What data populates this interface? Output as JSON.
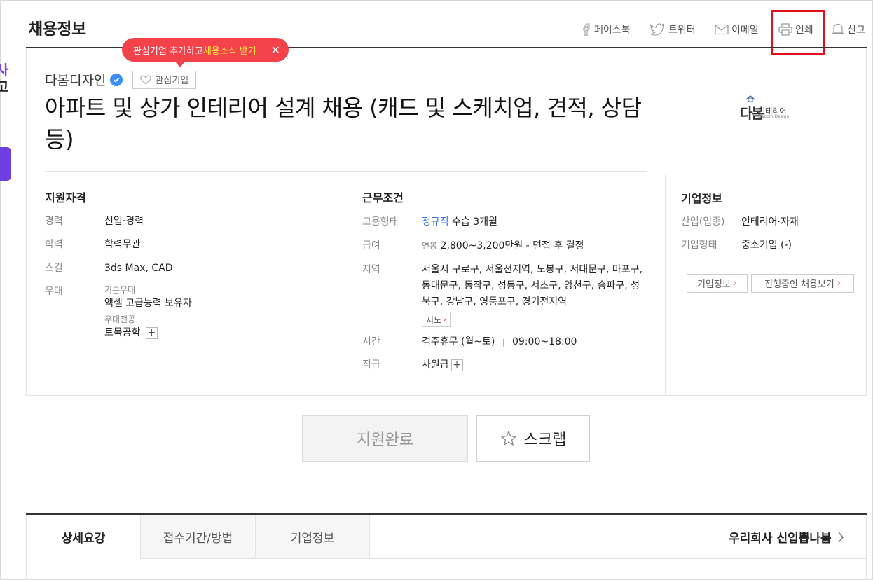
{
  "left_ad": {
    "text1": "사",
    "text2": "고"
  },
  "header": {
    "title": "채용정보",
    "share": {
      "facebook": "페이스북",
      "twitter": "트위터",
      "email": "이메일",
      "print": "인쇄",
      "report": "신고"
    }
  },
  "tooltip": {
    "text_before": "관심기업 추가하고 ",
    "text_highlight": "채용소식 받기",
    "close": "✕"
  },
  "company": {
    "name": "다봄디자인",
    "fav_label": "관심기업"
  },
  "job": {
    "title": "아파트 및 상가 인테리어 설계 채용 (캐드 및 스케치업, 견적, 상담 등)"
  },
  "qualifications": {
    "title": "지원자격",
    "career_label": "경력",
    "career_value": "신입·경력",
    "education_label": "학력",
    "education_value": "학력무관",
    "skill_label": "스킬",
    "skill_value": "3ds Max, CAD",
    "benefit_label": "우대",
    "benefit_basic_label": "기본우대",
    "benefit_basic_value": "엑셀 고급능력 보유자",
    "benefit_major_label": "우대전공",
    "benefit_major_value": "토목공학",
    "plus": "+"
  },
  "conditions": {
    "title": "근무조건",
    "type_label": "고용형태",
    "type_value": "정규직",
    "type_extra": "수습 3개월",
    "salary_label": "급여",
    "salary_prefix": "연봉",
    "salary_value": "2,800~3,200만원 - 면접 후 결정",
    "region_label": "지역",
    "region_value": "서울시 구로구, 서울전지역, 도봉구, 서대문구, 마포구, 동대문구, 동작구, 성동구, 서초구, 양천구, 송파구, 성북구, 강남구, 영등포구, 경기전지역",
    "map_label": "지도",
    "time_label": "시간",
    "time_value": "격주휴무 (월~토)",
    "time_sep": "|",
    "time_hours": "09:00~18:00",
    "rank_label": "직급",
    "rank_value": "사원급",
    "plus": "+"
  },
  "company_info": {
    "title": "기업정보",
    "industry_label": "산업(업종)",
    "industry_value": "인테리어·자재",
    "type_label": "기업형태",
    "type_value": "중소기업 (-)",
    "btn_info": "기업정보",
    "btn_jobs": "진행중인 채용보기",
    "logo_main": "다봄",
    "logo_sub": "인테리어",
    "logo_en": "Dabom Design"
  },
  "actions": {
    "apply": "지원완료",
    "scrap": "스크랩"
  },
  "tabs": [
    {
      "label": "상세요강"
    },
    {
      "label": "접수기간/방법"
    },
    {
      "label": "기업정보"
    }
  ],
  "new_grad": "우리회사 신입뽑나봄",
  "colors": {
    "accent_red": "#f4424a",
    "link_blue": "#3d76cf",
    "highlight_yellow": "#ffe94a"
  }
}
